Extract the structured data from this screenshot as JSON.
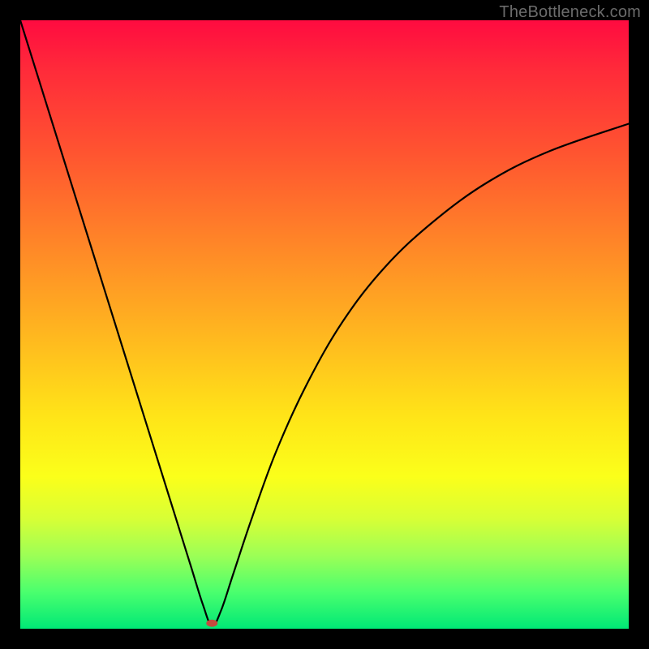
{
  "watermark": "TheBottleneck.com",
  "chart_data": {
    "type": "line",
    "title": "",
    "xlabel": "",
    "ylabel": "",
    "xlim": [
      0,
      100
    ],
    "ylim": [
      0,
      100
    ],
    "series": [
      {
        "name": "curve",
        "x": [
          0,
          5,
          10,
          15,
          20,
          25,
          28,
          30,
          31.5,
          33,
          35,
          38,
          42,
          47,
          53,
          60,
          68,
          77,
          87,
          100
        ],
        "y": [
          100,
          84,
          68,
          52,
          36,
          20,
          10.4,
          4,
          0.5,
          3,
          9,
          18,
          29,
          40,
          50.5,
          59.5,
          67,
          73.5,
          78.5,
          83
        ]
      }
    ],
    "marker": {
      "x": 31.5,
      "y": 0.9,
      "color": "#c54b3f"
    }
  }
}
